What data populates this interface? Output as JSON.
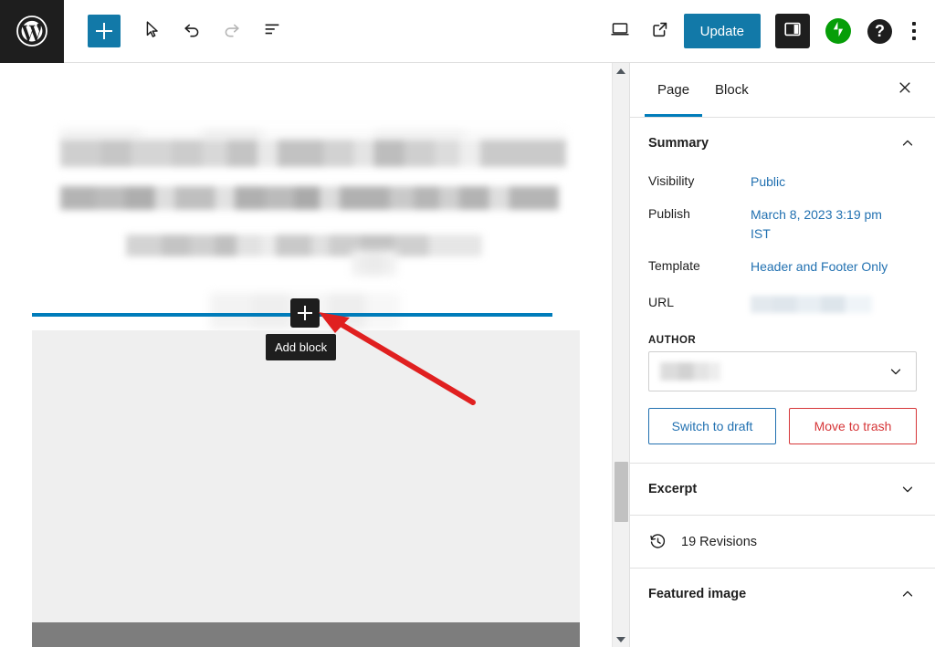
{
  "toolbar": {
    "logo_icon": "wordpress-logo-icon",
    "add_block_icon": "plus-icon",
    "tools_icon": "cursor-tools-icon",
    "undo_icon": "undo-arrow-icon",
    "redo_icon": "redo-arrow-icon",
    "list_view_icon": "list-view-icon",
    "preview_icon": "desktop-preview-icon",
    "view_site_icon": "external-link-icon",
    "update_label": "Update",
    "settings_toggle_icon": "settings-panel-icon",
    "jetpack_icon": "jetpack-bolt-icon",
    "help_icon": "help-question-icon",
    "options_icon": "kebab-menu-icon"
  },
  "canvas": {
    "inserter_icon": "plus-icon",
    "tooltip_label": "Add block",
    "insertion_line_color": "#007cba",
    "annotation_arrow_color": "#e02020",
    "placeholder_block_color": "#efefef",
    "footer_bar_color": "#7d7d7d"
  },
  "scrollbar": {
    "up_arrow_icon": "scroll-up-arrow-icon",
    "down_arrow_icon": "scroll-down-arrow-icon"
  },
  "sidebar": {
    "tabs": [
      {
        "label": "Page",
        "active": true
      },
      {
        "label": "Block",
        "active": false
      }
    ],
    "close_icon": "close-icon",
    "summary": {
      "title": "Summary",
      "collapse_icon": "chevron-up-icon",
      "fields": [
        {
          "label": "Visibility",
          "value": "Public",
          "redacted": false
        },
        {
          "label": "Publish",
          "value": "March 8, 2023 3:19 pm IST",
          "redacted": false
        },
        {
          "label": "Template",
          "value": "Header and Footer Only",
          "redacted": false
        },
        {
          "label": "URL",
          "value": "",
          "redacted": true
        }
      ],
      "author_label": "AUTHOR",
      "author_value": "",
      "author_redacted": true,
      "author_dropdown_icon": "chevron-down-icon",
      "switch_to_draft_label": "Switch to draft",
      "move_to_trash_label": "Move to trash"
    },
    "excerpt": {
      "title": "Excerpt",
      "expand_icon": "chevron-down-icon"
    },
    "revisions": {
      "label": "19 Revisions",
      "icon": "revision-history-icon"
    },
    "featured_image": {
      "title": "Featured image",
      "collapse_icon": "chevron-up-icon"
    }
  },
  "colors": {
    "accent_blue": "#007cba",
    "button_blue": "#1279a8",
    "link_blue": "#2271b1",
    "danger_red": "#d63638",
    "jetpack_green": "#069e08",
    "dark": "#1e1e1e"
  }
}
